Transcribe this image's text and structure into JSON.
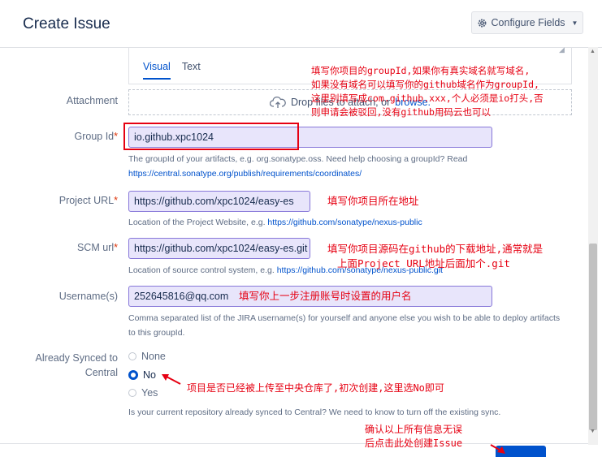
{
  "header": {
    "title": "Create Issue",
    "configure_fields": "Configure Fields"
  },
  "editor": {
    "tab_visual": "Visual",
    "tab_text": "Text"
  },
  "attachment": {
    "label": "Attachment",
    "drop_text": "Drop files to attach, or",
    "browse": "browse."
  },
  "group_id": {
    "label": "Group Id",
    "value": "io.github.xpc1024",
    "help": "The groupId of your artifacts, e.g. org.sonatype.oss. Need help choosing a groupId? Read",
    "help_link": "https://central.sonatype.org/publish/requirements/coordinates/"
  },
  "project_url": {
    "label": "Project URL",
    "value": "https://github.com/xpc1024/easy-es",
    "help": "Location of the Project Website, e.g.",
    "help_link": "https://github.com/sonatype/nexus-public"
  },
  "scm_url": {
    "label": "SCM url",
    "value": "https://github.com/xpc1024/easy-es.git",
    "help": "Location of source control system, e.g.",
    "help_link": "https://github.com/sonatype/nexus-public.git"
  },
  "usernames": {
    "label": "Username(s)",
    "value": "252645816@qq.com",
    "help_line1": "Comma separated list of the JIRA username(s) for yourself and anyone else you wish to be able to deploy artifacts",
    "help_line2": "to this groupId."
  },
  "already_synced": {
    "label_line1": "Already Synced to",
    "label_line2": "Central",
    "options": [
      "None",
      "No",
      "Yes"
    ],
    "selected": "No",
    "help": "Is your current repository already synced to Central? We need to know to turn off the existing sync."
  },
  "annotations": {
    "group_id": [
      "填写你项目的groupId,如果你有真实域名就写域名,",
      "如果没有域名可以填写你的github域名作为groupId,",
      "这里别填写成com.github.xxx,个人必须是io打头,否",
      "则申请会被驳回,没有github用码云也可以"
    ],
    "project_url": "填写你项目所在地址",
    "scm_url": [
      "填写你项目源码在github的下载地址,通常就是",
      "上面Project URL地址后面加个.git"
    ],
    "username": "填写你上一步注册账号时设置的用户名",
    "synced": "项目是否已经被上传至中央仓库了,初次创建,这里选No即可",
    "create": [
      "确认以上所有信息无误",
      "后点击此处创建Issue"
    ]
  },
  "colors": {
    "annotation": "#e60012",
    "input_bg": "#e8e5fb",
    "input_border": "#8777d9",
    "link": "#0052cc"
  }
}
